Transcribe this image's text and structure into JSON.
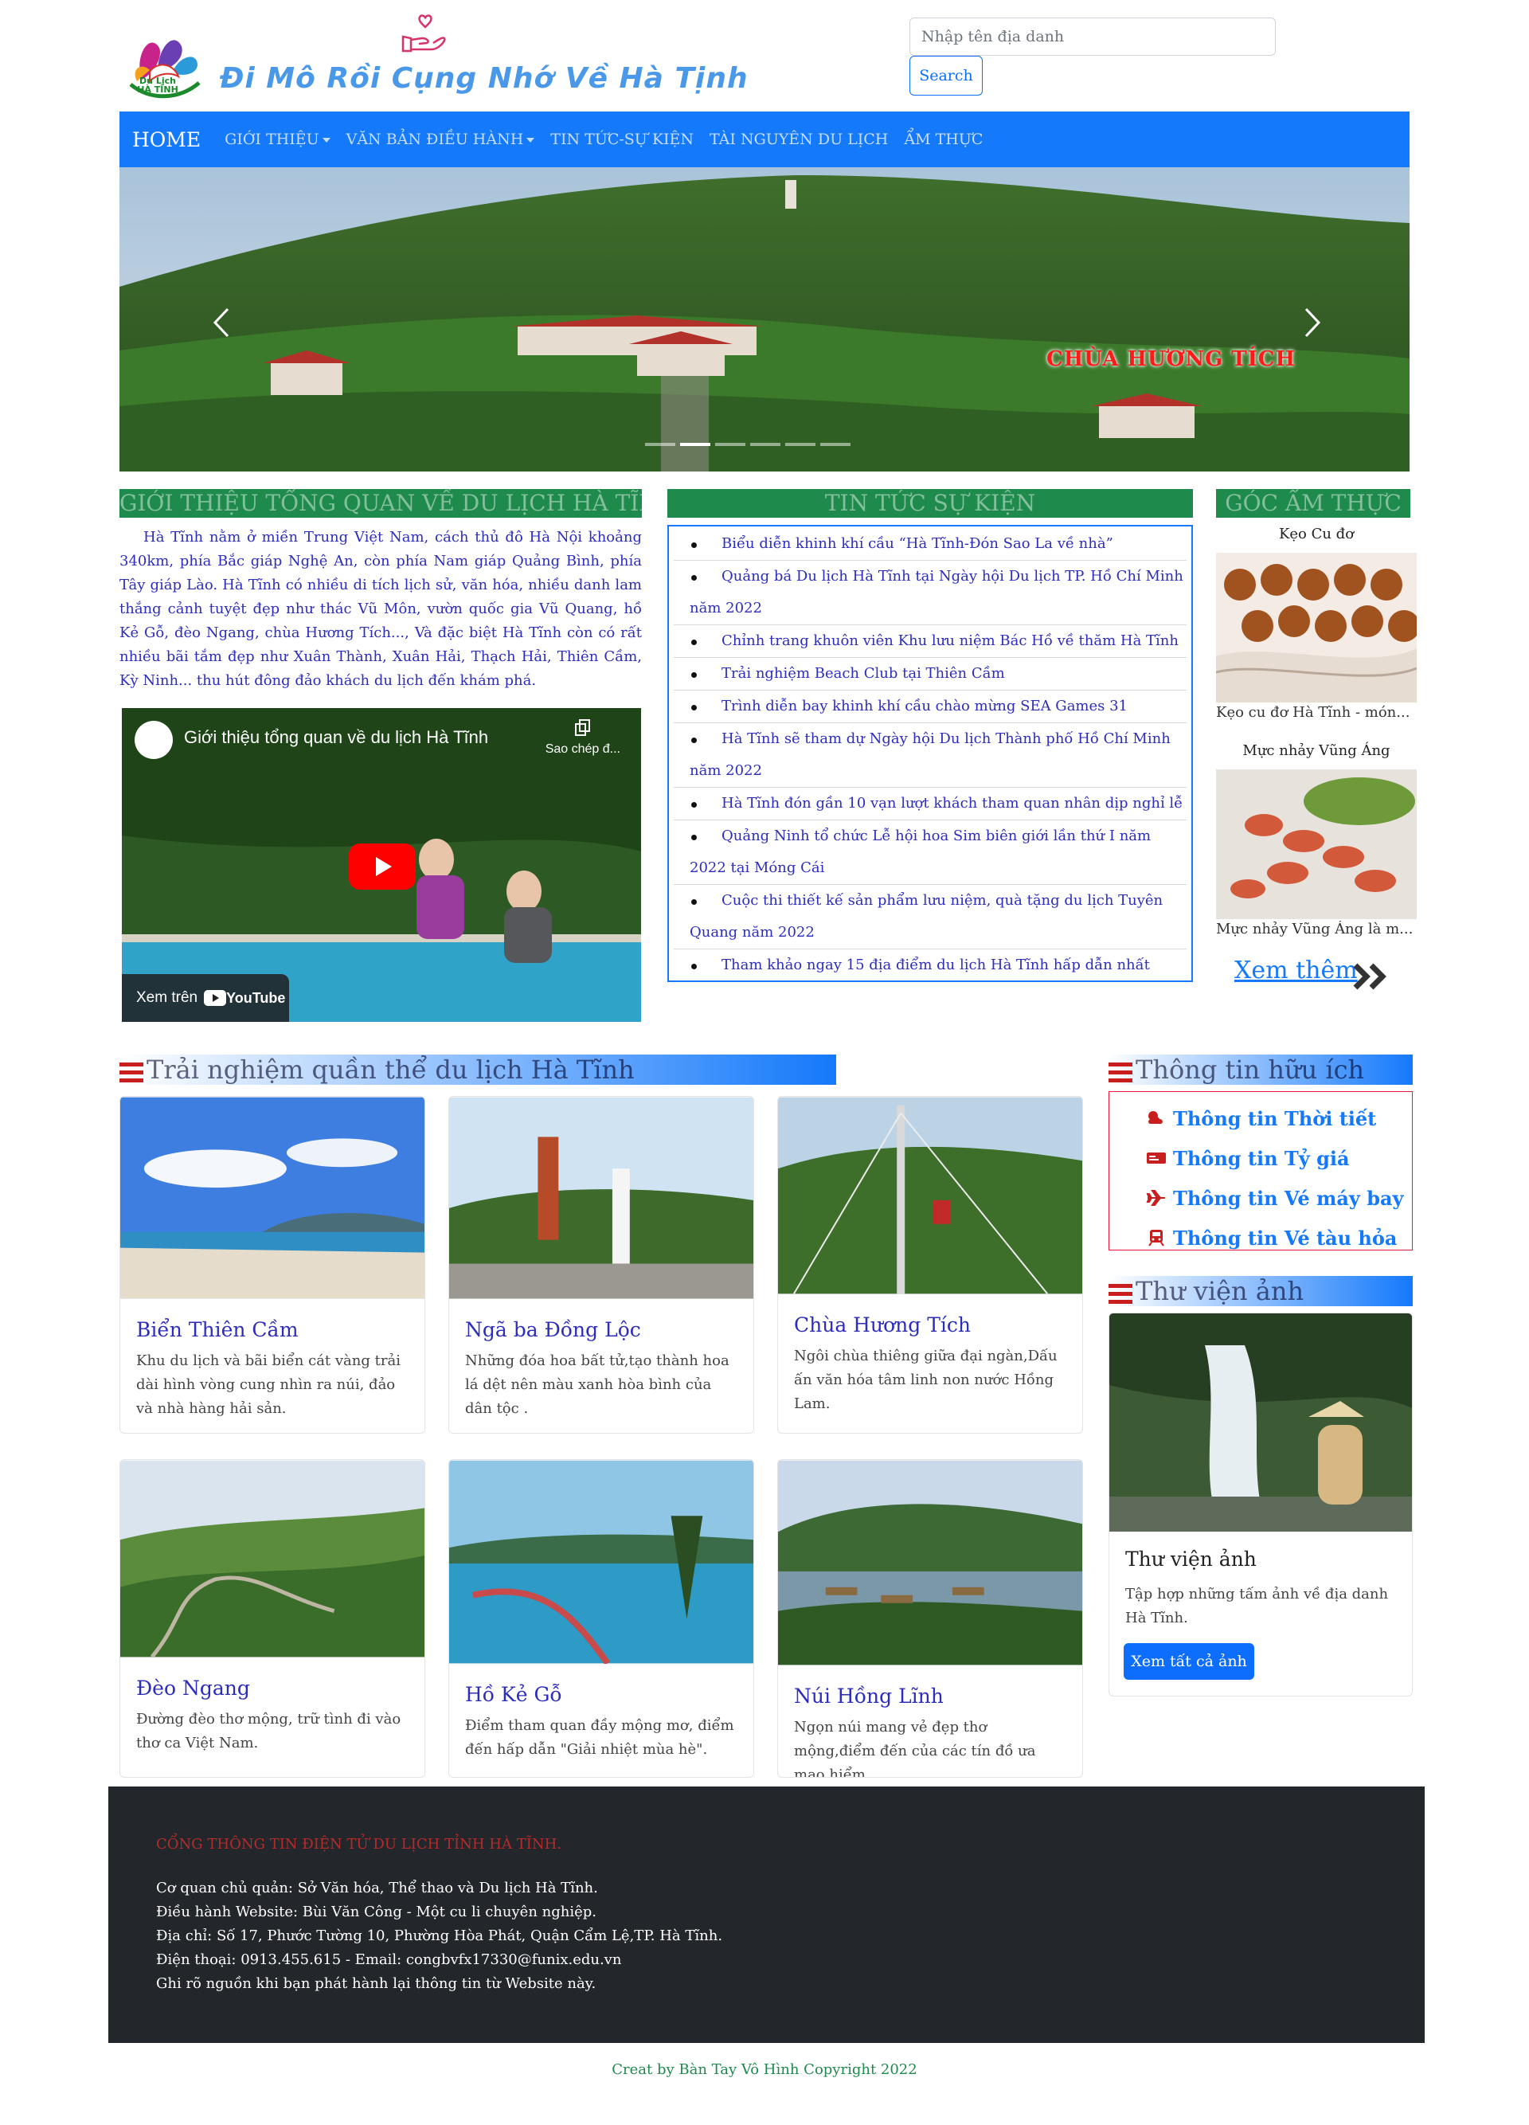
{
  "header": {
    "logo_text": "Du Lịch\nHÀ TĨNH",
    "slogan": "Đi Mô Rồi Cụng Nhớ Về Hà Tịnh",
    "search_placeholder": "Nhập tên địa danh",
    "search_button": "Search"
  },
  "nav": {
    "home": "HOME",
    "items": [
      "GIỚI THIỆU",
      "VĂN BẢN ĐIỀU HÀNH",
      "TIN TỨC-SỰ KIỆN",
      "TÀI NGUYÊN DU LỊCH",
      "ẨM THỰC"
    ]
  },
  "carousel": {
    "caption": "CHÙA HƯƠNG TÍCH",
    "active_slide": 2,
    "slide_count": 6
  },
  "intro": {
    "heading": "GIỚI THIỆU TỔNG QUAN VỀ DU LỊCH HÀ TĨNH",
    "text": "Hà Tĩnh nằm ở miền Trung Việt Nam, cách thủ đô Hà Nội khoảng 340km, phía Bắc giáp Nghệ An, còn phía Nam giáp Quảng Bình, phía Tây giáp Lào. Hà Tĩnh có nhiều di tích lịch sử, văn hóa, nhiều danh lam thắng cảnh tuyệt đẹp như thác Vũ Môn, vườn quốc gia Vũ Quang, hồ Kẻ Gỗ, đèo Ngang, chùa Hương Tích...,  Và đặc biệt Hà Tĩnh còn có rất nhiều bãi tắm đẹp như Xuân Thành, Xuân Hải, Thạch Hải, Thiên Cầm, Kỳ Ninh... thu hút đông đảo khách du lịch đến khám phá.",
    "video_title": "Giới thiệu tổng quan về du lịch Hà Tĩnh",
    "video_copy": "Sao chép đ...",
    "video_watch": "Xem trên",
    "video_brand": "YouTube"
  },
  "news": {
    "heading": "TIN TỨC SỰ KIỆN",
    "items": [
      "Biểu diễn khinh khí cầu “Hà Tĩnh-Đón Sao La về nhà”",
      "Quảng bá Du lịch Hà Tĩnh tại Ngày hội Du lịch TP. Hồ Chí Minh năm 2022",
      "Chỉnh trang khuôn viên Khu lưu niệm Bác Hồ về thăm Hà Tĩnh",
      "Trải nghiệm Beach Club tại Thiên Cầm",
      "Trình diễn bay khinh khí cầu chào mừng SEA Games 31",
      "Hà Tĩnh sẽ tham dự Ngày hội Du lịch Thành phố Hồ Chí Minh năm 2022",
      "Hà Tĩnh đón gần 10 vạn lượt khách tham quan nhân dịp nghỉ lễ",
      "Quảng Ninh tổ chức Lễ hội hoa Sim biên giới lần thứ I năm 2022 tại Móng Cái",
      "Cuộc thi thiết kế sản phẩm lưu niệm, quà tặng du lịch Tuyên Quang năm 2022",
      "Tham khảo ngay 15 địa điểm du lịch Hà Tĩnh hấp dẫn nhất"
    ]
  },
  "food": {
    "heading": "GÓC ẨM THỰC",
    "items": [
      {
        "name": "Kẹo Cu đơ",
        "desc": "Kẹo cu đơ Hà Tĩnh - món..."
      },
      {
        "name": "Mực nhảy Vũng Áng",
        "desc": "Mực nhảy Vũng Áng là m..."
      }
    ],
    "more": "Xem thêm"
  },
  "experience": {
    "heading": "Trải nghiệm quần thể du lịch Hà Tĩnh",
    "cards": [
      {
        "title": "Biển Thiên Cầm",
        "text": "Khu du lịch và bãi biển cát vàng trải dài hình vòng cung nhìn ra núi, đảo và nhà hàng hải sản."
      },
      {
        "title": "Ngã ba Đồng Lộc",
        "text": "Những đóa hoa bất tử,tạo thành hoa lá dệt nên màu xanh hòa bình của dân tộc ."
      },
      {
        "title": "Chùa Hương Tích",
        "text": "Ngôi chùa thiêng giữa đại ngàn,Dấu ấn văn hóa tâm linh non nước Hồng Lam."
      },
      {
        "title": "Đèo Ngang",
        "text": "Đường đèo thơ mộng, trữ tình đi vào thơ ca Việt Nam."
      },
      {
        "title": "Hồ Kẻ Gỗ",
        "text": "Điểm tham quan đầy mộng mơ, điểm đến hấp dẫn \"Giải nhiệt mùa hè\"."
      },
      {
        "title": "Núi Hồng Lĩnh",
        "text": "Ngọn núi mang vẻ đẹp thơ mộng,điểm đến của các tín đồ ưa mạo hiểm."
      }
    ]
  },
  "useful": {
    "heading": "Thông tin hữu ích",
    "items": [
      "Thông tin Thời tiết",
      "Thông tin Tỷ giá",
      "Thông tin Vé máy bay",
      "Thông tin Vé tàu hỏa"
    ]
  },
  "gallery": {
    "heading": "Thư viện ảnh",
    "title": "Thư viện ảnh",
    "text": "Tập hợp những tấm ảnh về địa danh Hà Tĩnh.",
    "button": "Xem tất cả ảnh"
  },
  "footer": {
    "title": "CỔNG THÔNG TIN ĐIỆN TỬ DU LỊCH TỈNH HÀ TĨNH.",
    "lines": [
      "Cơ quan chủ quản: Sở Văn hóa, Thể thao và Du lịch Hà Tĩnh.",
      "Điều hành Website: Bùi Văn Công - Một cu li chuyên nghiệp.",
      "Địa chỉ: Số 17, Phước Tường 10, Phường Hòa Phát, Quận Cẩm Lệ,TP. Hà Tĩnh.",
      "Điện thoại: 0913.455.615 - Email: congbvfx17330@funix.edu.vn",
      "Ghi rõ nguồn khi bạn phát hành lại thông tin từ Website này."
    ],
    "copyright": "Creat by Bàn Tay Vô Hình Copyright 2022"
  },
  "colors": {
    "nav_blue": "#1479fb",
    "section_green": "#1e8a4c",
    "link_blue": "#2d2dbd",
    "footer_bg": "#23272b",
    "caption_red": "#ff1a1a"
  }
}
